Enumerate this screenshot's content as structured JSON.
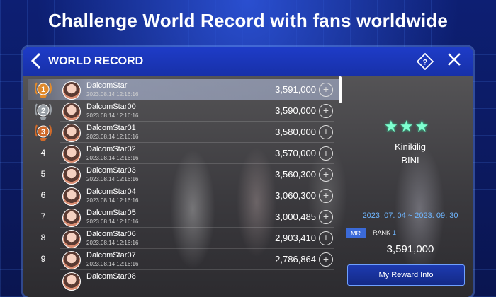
{
  "banner": {
    "text": "Challenge World Record with fans worldwide"
  },
  "header": {
    "title": "WORLD RECORD",
    "back_icon": "chevron-left-icon",
    "help_icon": "help-diamond-icon",
    "close_icon": "close-icon"
  },
  "entries": [
    {
      "rank": "1",
      "medal": "gold",
      "name": "DalcomStar",
      "date": "2023.08.14 12:16:16",
      "score": "3,591,000",
      "is_me": true
    },
    {
      "rank": "2",
      "medal": "silver",
      "name": "DalcomStar00",
      "date": "2023.08.14 12:16:16",
      "score": "3,590,000",
      "is_me": false
    },
    {
      "rank": "3",
      "medal": "bronze",
      "name": "DalcomStar01",
      "date": "2023.08.14 12:16:16",
      "score": "3,580,000",
      "is_me": false
    },
    {
      "rank": "4",
      "medal": "",
      "name": "DalcomStar02",
      "date": "2023.08.14 12:16:16",
      "score": "3,570,000",
      "is_me": false
    },
    {
      "rank": "5",
      "medal": "",
      "name": "DalcomStar03",
      "date": "2023.08.14 12:16:16",
      "score": "3,560,300",
      "is_me": false
    },
    {
      "rank": "6",
      "medal": "",
      "name": "DalcomStar04",
      "date": "2023.08.14 12:16:16",
      "score": "3,060,300",
      "is_me": false
    },
    {
      "rank": "7",
      "medal": "",
      "name": "DalcomStar05",
      "date": "2023.08.14 12:16:16",
      "score": "3,000,485",
      "is_me": false
    },
    {
      "rank": "8",
      "medal": "",
      "name": "DalcomStar06",
      "date": "2023.08.14 12:16:16",
      "score": "2,903,410",
      "is_me": false
    },
    {
      "rank": "9",
      "medal": "",
      "name": "DalcomStar07",
      "date": "2023.08.14 12:16:16",
      "score": "2,786,864",
      "is_me": false
    },
    {
      "rank": "",
      "medal": "",
      "name": "DalcomStar08",
      "date": "",
      "score": "",
      "is_me": false
    }
  ],
  "song_info": {
    "stars": "★★★",
    "song": "Kinikilig",
    "artist": "BINI",
    "period": "2023. 07. 04 ~ 2023. 09. 30",
    "mr_label": "MR",
    "rank_label": "RANK",
    "rank_value": "1",
    "best_score": "3,591,000",
    "reward_button": "My Reward Info"
  },
  "colors": {
    "accent": "#1e3cc8",
    "highlight": "#6fb6ff",
    "star": "#7fffd0"
  }
}
